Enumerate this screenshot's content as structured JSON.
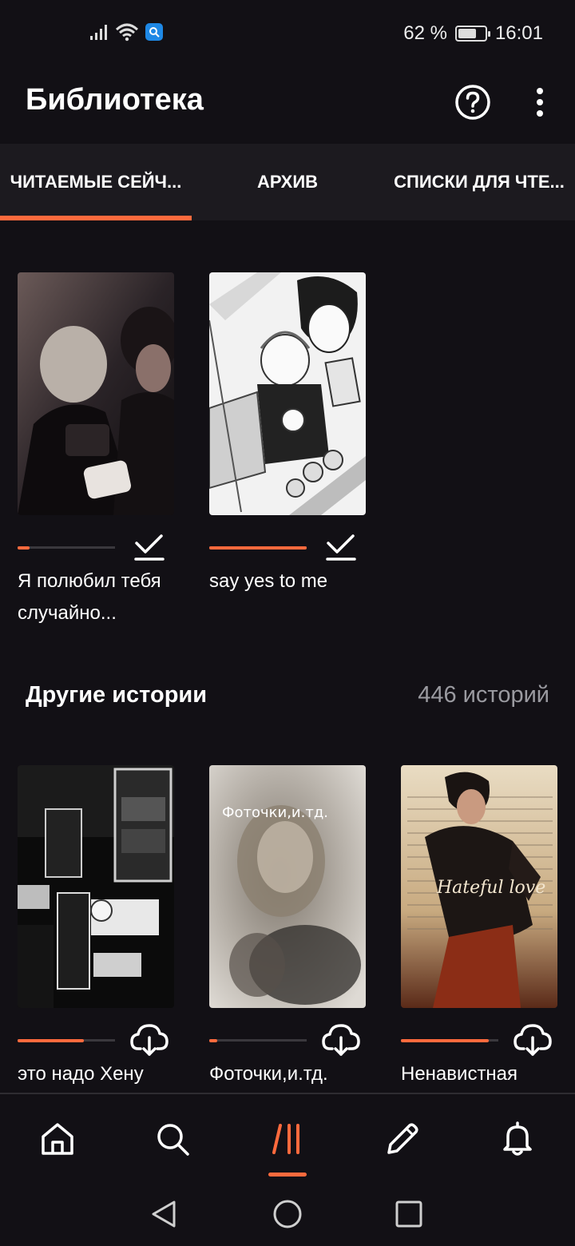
{
  "status_bar": {
    "battery_text": "62 %",
    "time": "16:01"
  },
  "header": {
    "title": "Библиотека",
    "help_icon": "question-circle-icon",
    "more_icon": "more-vertical-icon"
  },
  "tabs": [
    {
      "label": "ЧИТАЕМЫЕ СЕЙЧ...",
      "active": true
    },
    {
      "label": "АРХИВ",
      "active": false
    },
    {
      "label": "СПИСКИ ДЛЯ ЧТЕ...",
      "active": false
    }
  ],
  "current_reads": [
    {
      "title": "Я полюбил тебя случайно...",
      "progress": 0.12,
      "status_icon": "check-icon"
    },
    {
      "title": "say yes to me",
      "progress": 1.0,
      "status_icon": "check-icon"
    }
  ],
  "other_stories": {
    "title": "Другие истории",
    "count": "446 историй",
    "items": [
      {
        "title": "это надо Хену",
        "progress": 0.68,
        "status_icon": "download-cloud-icon",
        "cover_text": ""
      },
      {
        "title": "Фоточки,и.тд.",
        "progress": 0.08,
        "status_icon": "download-cloud-icon",
        "cover_text": "Фоточки,и.тд."
      },
      {
        "title": "Ненавистная",
        "progress": 0.9,
        "status_icon": "download-cloud-icon",
        "cover_text": "Hateful love"
      }
    ]
  },
  "bottom_nav": [
    {
      "name": "home-icon",
      "active": false
    },
    {
      "name": "search-icon",
      "active": false
    },
    {
      "name": "library-icon",
      "active": true
    },
    {
      "name": "write-icon",
      "active": false
    },
    {
      "name": "notifications-icon",
      "active": false
    }
  ],
  "colors": {
    "accent": "#ff6a3d",
    "background": "#121015",
    "tab_bar": "#1c1a1f",
    "muted_text": "#9a9aa0"
  }
}
